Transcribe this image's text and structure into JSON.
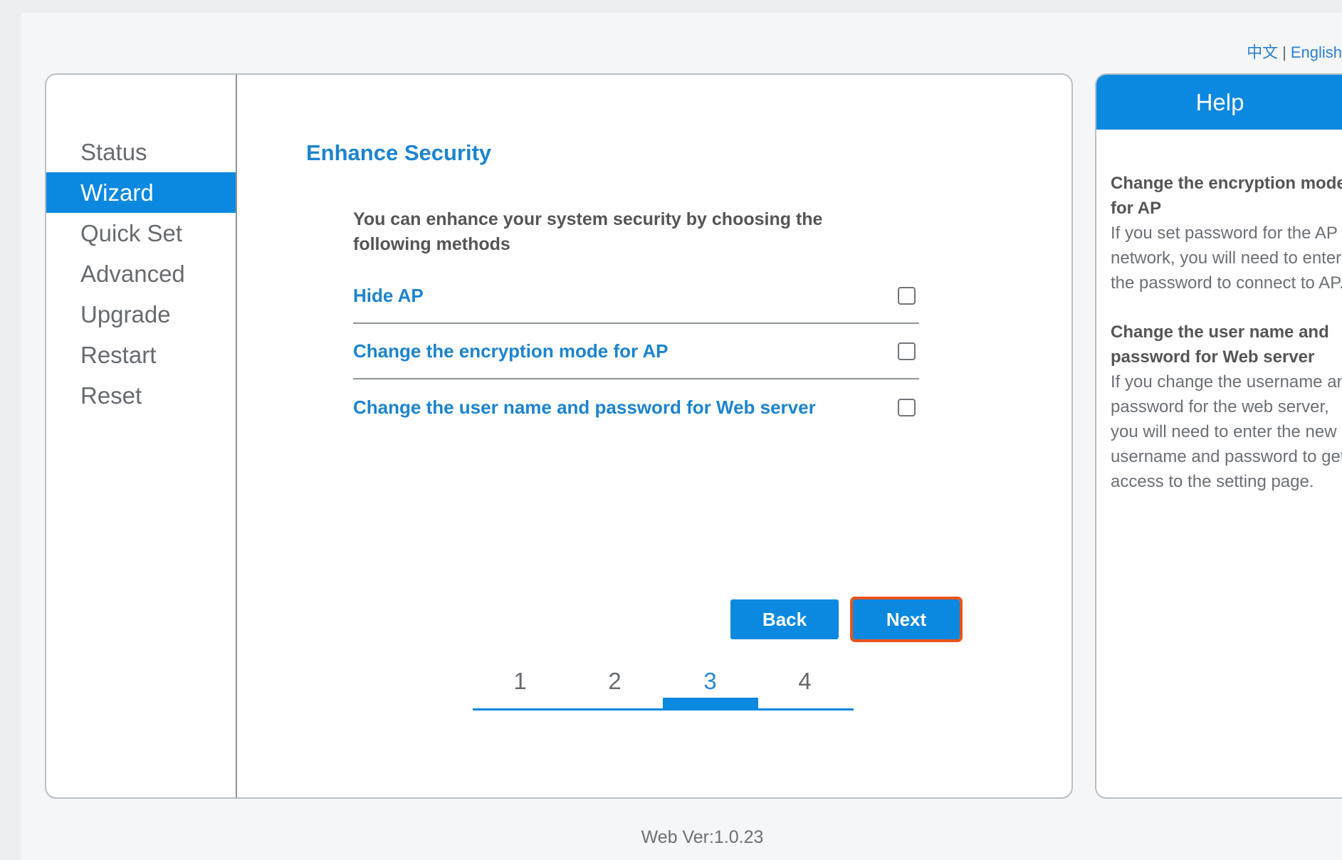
{
  "language": {
    "chinese": "中文",
    "separator": "|",
    "english": "English"
  },
  "sidebar": {
    "items": [
      {
        "label": "Status"
      },
      {
        "label": "Wizard"
      },
      {
        "label": "Quick Set"
      },
      {
        "label": "Advanced"
      },
      {
        "label": "Upgrade"
      },
      {
        "label": "Restart"
      },
      {
        "label": "Reset"
      }
    ],
    "active": "Wizard"
  },
  "wizard": {
    "title": "Enhance Security",
    "intro": "You can enhance your system security by choosing the following methods",
    "options": [
      {
        "label": "Hide AP",
        "checked": false
      },
      {
        "label": "Change the encryption mode for AP",
        "checked": false
      },
      {
        "label": "Change the user name and password for Web server",
        "checked": false
      }
    ],
    "back_label": "Back",
    "next_label": "Next",
    "steps": [
      "1",
      "2",
      "3",
      "4"
    ],
    "current_step": "3"
  },
  "help": {
    "title": "Help",
    "sections": [
      {
        "title": "Change the encryption mode for AP",
        "text": "If you set password for the AP network, you will need to enter the password to connect to AP."
      },
      {
        "title": "Change the user name and password for Web server",
        "text": "If you change the username and password for the web server, you will need to enter the new username and password to get access to the setting page."
      }
    ]
  },
  "footer": {
    "version": "Web Ver:1.0.23"
  },
  "colors": {
    "accent": "#0b88e0",
    "link": "#1d84cf",
    "highlight": "#e8541c"
  }
}
